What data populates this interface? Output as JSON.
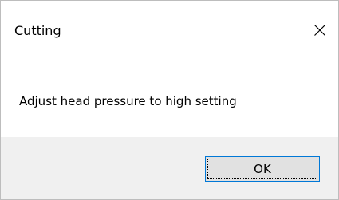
{
  "dialog": {
    "title": "Cutting",
    "message": "Adjust head pressure to high setting",
    "ok_label": "OK",
    "close_icon": "close-icon"
  },
  "colors": {
    "footer_bg": "#f0f0f0",
    "button_border_focus": "#0078d7",
    "button_bg": "#e1e1e1"
  }
}
